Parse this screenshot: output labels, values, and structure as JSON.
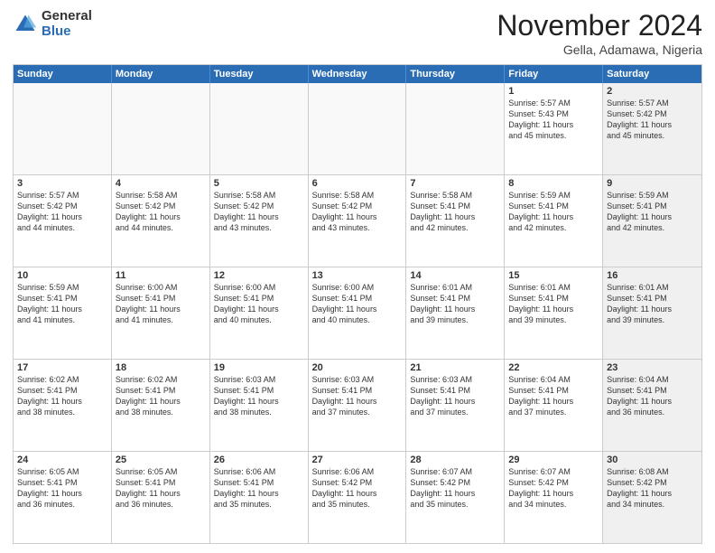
{
  "logo": {
    "general": "General",
    "blue": "Blue"
  },
  "header": {
    "month": "November 2024",
    "location": "Gella, Adamawa, Nigeria"
  },
  "weekdays": [
    "Sunday",
    "Monday",
    "Tuesday",
    "Wednesday",
    "Thursday",
    "Friday",
    "Saturday"
  ],
  "rows": [
    [
      {
        "day": "",
        "empty": true
      },
      {
        "day": "",
        "empty": true
      },
      {
        "day": "",
        "empty": true
      },
      {
        "day": "",
        "empty": true
      },
      {
        "day": "",
        "empty": true
      },
      {
        "day": "1",
        "lines": [
          "Sunrise: 5:57 AM",
          "Sunset: 5:43 PM",
          "Daylight: 11 hours",
          "and 45 minutes."
        ]
      },
      {
        "day": "2",
        "shaded": true,
        "lines": [
          "Sunrise: 5:57 AM",
          "Sunset: 5:42 PM",
          "Daylight: 11 hours",
          "and 45 minutes."
        ]
      }
    ],
    [
      {
        "day": "3",
        "lines": [
          "Sunrise: 5:57 AM",
          "Sunset: 5:42 PM",
          "Daylight: 11 hours",
          "and 44 minutes."
        ]
      },
      {
        "day": "4",
        "lines": [
          "Sunrise: 5:58 AM",
          "Sunset: 5:42 PM",
          "Daylight: 11 hours",
          "and 44 minutes."
        ]
      },
      {
        "day": "5",
        "lines": [
          "Sunrise: 5:58 AM",
          "Sunset: 5:42 PM",
          "Daylight: 11 hours",
          "and 43 minutes."
        ]
      },
      {
        "day": "6",
        "lines": [
          "Sunrise: 5:58 AM",
          "Sunset: 5:42 PM",
          "Daylight: 11 hours",
          "and 43 minutes."
        ]
      },
      {
        "day": "7",
        "lines": [
          "Sunrise: 5:58 AM",
          "Sunset: 5:41 PM",
          "Daylight: 11 hours",
          "and 42 minutes."
        ]
      },
      {
        "day": "8",
        "lines": [
          "Sunrise: 5:59 AM",
          "Sunset: 5:41 PM",
          "Daylight: 11 hours",
          "and 42 minutes."
        ]
      },
      {
        "day": "9",
        "shaded": true,
        "lines": [
          "Sunrise: 5:59 AM",
          "Sunset: 5:41 PM",
          "Daylight: 11 hours",
          "and 42 minutes."
        ]
      }
    ],
    [
      {
        "day": "10",
        "lines": [
          "Sunrise: 5:59 AM",
          "Sunset: 5:41 PM",
          "Daylight: 11 hours",
          "and 41 minutes."
        ]
      },
      {
        "day": "11",
        "lines": [
          "Sunrise: 6:00 AM",
          "Sunset: 5:41 PM",
          "Daylight: 11 hours",
          "and 41 minutes."
        ]
      },
      {
        "day": "12",
        "lines": [
          "Sunrise: 6:00 AM",
          "Sunset: 5:41 PM",
          "Daylight: 11 hours",
          "and 40 minutes."
        ]
      },
      {
        "day": "13",
        "lines": [
          "Sunrise: 6:00 AM",
          "Sunset: 5:41 PM",
          "Daylight: 11 hours",
          "and 40 minutes."
        ]
      },
      {
        "day": "14",
        "lines": [
          "Sunrise: 6:01 AM",
          "Sunset: 5:41 PM",
          "Daylight: 11 hours",
          "and 39 minutes."
        ]
      },
      {
        "day": "15",
        "lines": [
          "Sunrise: 6:01 AM",
          "Sunset: 5:41 PM",
          "Daylight: 11 hours",
          "and 39 minutes."
        ]
      },
      {
        "day": "16",
        "shaded": true,
        "lines": [
          "Sunrise: 6:01 AM",
          "Sunset: 5:41 PM",
          "Daylight: 11 hours",
          "and 39 minutes."
        ]
      }
    ],
    [
      {
        "day": "17",
        "lines": [
          "Sunrise: 6:02 AM",
          "Sunset: 5:41 PM",
          "Daylight: 11 hours",
          "and 38 minutes."
        ]
      },
      {
        "day": "18",
        "lines": [
          "Sunrise: 6:02 AM",
          "Sunset: 5:41 PM",
          "Daylight: 11 hours",
          "and 38 minutes."
        ]
      },
      {
        "day": "19",
        "lines": [
          "Sunrise: 6:03 AM",
          "Sunset: 5:41 PM",
          "Daylight: 11 hours",
          "and 38 minutes."
        ]
      },
      {
        "day": "20",
        "lines": [
          "Sunrise: 6:03 AM",
          "Sunset: 5:41 PM",
          "Daylight: 11 hours",
          "and 37 minutes."
        ]
      },
      {
        "day": "21",
        "lines": [
          "Sunrise: 6:03 AM",
          "Sunset: 5:41 PM",
          "Daylight: 11 hours",
          "and 37 minutes."
        ]
      },
      {
        "day": "22",
        "lines": [
          "Sunrise: 6:04 AM",
          "Sunset: 5:41 PM",
          "Daylight: 11 hours",
          "and 37 minutes."
        ]
      },
      {
        "day": "23",
        "shaded": true,
        "lines": [
          "Sunrise: 6:04 AM",
          "Sunset: 5:41 PM",
          "Daylight: 11 hours",
          "and 36 minutes."
        ]
      }
    ],
    [
      {
        "day": "24",
        "lines": [
          "Sunrise: 6:05 AM",
          "Sunset: 5:41 PM",
          "Daylight: 11 hours",
          "and 36 minutes."
        ]
      },
      {
        "day": "25",
        "lines": [
          "Sunrise: 6:05 AM",
          "Sunset: 5:41 PM",
          "Daylight: 11 hours",
          "and 36 minutes."
        ]
      },
      {
        "day": "26",
        "lines": [
          "Sunrise: 6:06 AM",
          "Sunset: 5:41 PM",
          "Daylight: 11 hours",
          "and 35 minutes."
        ]
      },
      {
        "day": "27",
        "lines": [
          "Sunrise: 6:06 AM",
          "Sunset: 5:42 PM",
          "Daylight: 11 hours",
          "and 35 minutes."
        ]
      },
      {
        "day": "28",
        "lines": [
          "Sunrise: 6:07 AM",
          "Sunset: 5:42 PM",
          "Daylight: 11 hours",
          "and 35 minutes."
        ]
      },
      {
        "day": "29",
        "lines": [
          "Sunrise: 6:07 AM",
          "Sunset: 5:42 PM",
          "Daylight: 11 hours",
          "and 34 minutes."
        ]
      },
      {
        "day": "30",
        "shaded": true,
        "lines": [
          "Sunrise: 6:08 AM",
          "Sunset: 5:42 PM",
          "Daylight: 11 hours",
          "and 34 minutes."
        ]
      }
    ]
  ]
}
